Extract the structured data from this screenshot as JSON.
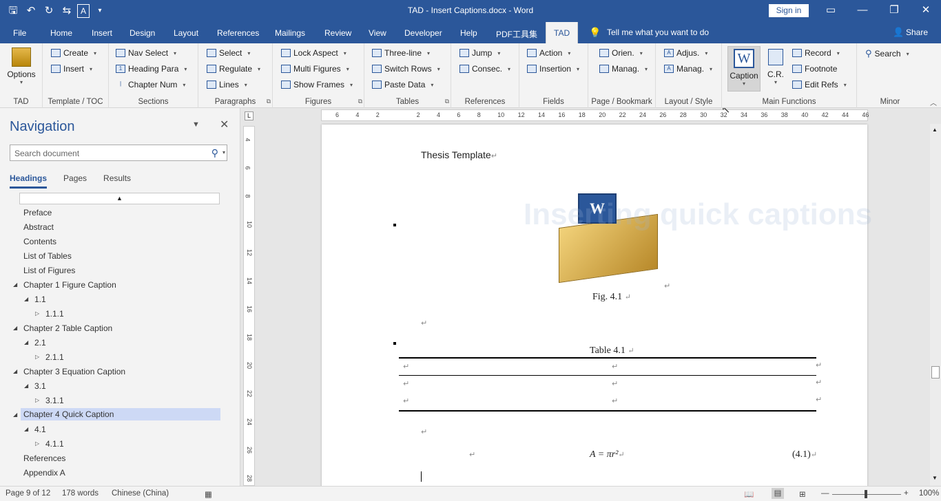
{
  "window": {
    "title": "TAD - Insert Captions.docx - Word",
    "signin": "Sign in"
  },
  "menu": {
    "tabs": [
      "File",
      "Home",
      "Insert",
      "Design",
      "Layout",
      "References",
      "Mailings",
      "Review",
      "View",
      "Developer",
      "Help",
      "PDF工具集",
      "TAD"
    ],
    "tellme": "Tell me what you want to do",
    "share": "Share"
  },
  "ribbon": {
    "tad": {
      "options": "Options",
      "label": "TAD"
    },
    "template": {
      "create": "Create",
      "insert": "Insert",
      "label": "Template / TOC"
    },
    "sections": {
      "nav_select": "Nav Select",
      "heading_para": "Heading Para",
      "chapter_num": "Chapter Num",
      "label": "Sections"
    },
    "paragraphs": {
      "select": "Select",
      "regulate": "Regulate",
      "lines": "Lines",
      "label": "Paragraphs"
    },
    "figures": {
      "lock_aspect": "Lock Aspect",
      "multi_figures": "Multi Figures",
      "show_frames": "Show Frames",
      "label": "Figures"
    },
    "tables": {
      "three_line": "Three-line",
      "switch_rows": "Switch Rows",
      "paste_data": "Paste Data",
      "label": "Tables"
    },
    "references": {
      "jump": "Jump",
      "consec": "Consec.",
      "label": "References"
    },
    "fields": {
      "action": "Action",
      "insertion": "Insertion",
      "label": "Fields"
    },
    "page_bookmark": {
      "orien": "Orien.",
      "manag": "Manag.",
      "label": "Page / Bookmark"
    },
    "layout_style": {
      "adjus": "Adjus.",
      "manag": "Manag.",
      "label": "Layout / Style"
    },
    "main": {
      "caption": "Caption",
      "cr": "C.R.",
      "record": "Record",
      "footnote": "Footnote",
      "edit_refs": "Edit Refs",
      "label": "Main Functions"
    },
    "minor": {
      "search": "Search",
      "label": "Minor"
    }
  },
  "overlay_text": "Inserting quick captions",
  "navigation": {
    "title": "Navigation",
    "search_placeholder": "Search document",
    "tabs": [
      "Headings",
      "Pages",
      "Results"
    ],
    "items": [
      "Preface",
      "Abstract",
      "Contents",
      "List of Tables",
      "List of Figures",
      "Chapter 1 Figure Caption",
      "1.1",
      "1.1.1",
      "Chapter 2 Table Caption",
      "2.1",
      "2.1.1",
      "Chapter 3 Equation Caption",
      "3.1",
      "3.1.1",
      "Chapter 4 Quick Caption",
      "4.1",
      "4.1.1",
      "References",
      "Appendix A"
    ],
    "selected": "Chapter 4 Quick Caption"
  },
  "document": {
    "header": "Thesis Template",
    "fig_caption": "Fig. 4.1",
    "table_caption": "Table 4.1",
    "equation": "A = πr²",
    "eq_number": "(4.1)",
    "para_mark": "↵"
  },
  "ruler": {
    "h": [
      "6",
      "4",
      "2",
      "",
      "2",
      "4",
      "6",
      "8",
      "10",
      "12",
      "14",
      "16",
      "18",
      "20",
      "22",
      "24",
      "26",
      "28",
      "30",
      "32",
      "34",
      "36",
      "38",
      "40",
      "42",
      "44",
      "46"
    ],
    "v": [
      "4",
      "6",
      "8",
      "10",
      "12",
      "14",
      "16",
      "18",
      "20",
      "22",
      "24",
      "26",
      "28"
    ]
  },
  "status": {
    "page": "Page 9 of 12",
    "words": "178 words",
    "language": "Chinese (China)",
    "zoom": "100%"
  },
  "colors": {
    "accent": "#2b579a",
    "selected": "#cdd9f5"
  }
}
